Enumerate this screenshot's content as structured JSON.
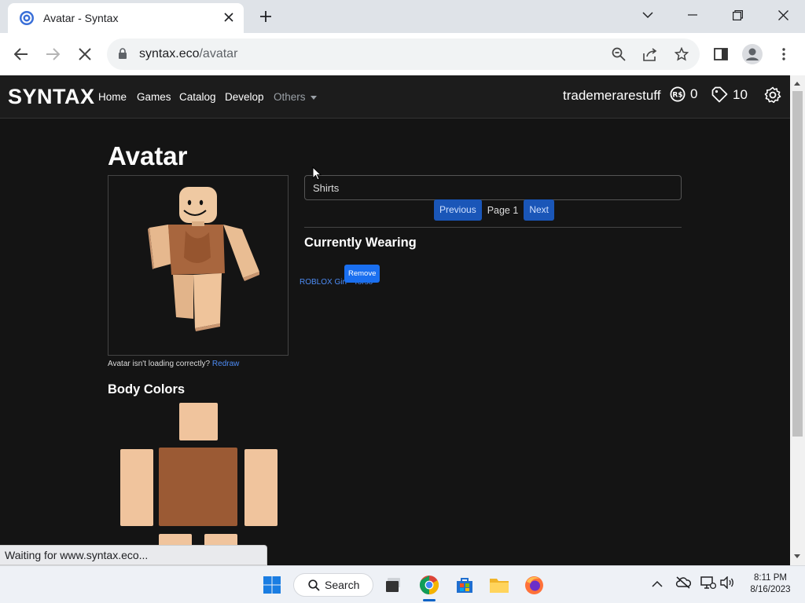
{
  "browser": {
    "tab_title": "Avatar - Syntax",
    "url_domain": "syntax.eco",
    "url_path": "/avatar",
    "status_text": "Waiting for www.syntax.eco..."
  },
  "site": {
    "brand": "SYNTAX",
    "nav": [
      "Home",
      "Games",
      "Catalog",
      "Develop"
    ],
    "nav_dropdown": "Others",
    "username": "trademerarestuff",
    "robux": "0",
    "tickets": "10"
  },
  "avatar_page": {
    "title": "Avatar",
    "loading_help": "Avatar isn't loading correctly?",
    "redraw_link": "Redraw",
    "body_colors_title": "Body Colors",
    "body_colors": {
      "head": "#f0c49d",
      "torso": "#9b5a34",
      "left_arm": "#f0c49d",
      "right_arm": "#f0c49d",
      "left_leg": "#f0c49d",
      "right_leg": "#f0c49d"
    },
    "category_field": "Shirts",
    "pager": {
      "previous": "Previous",
      "page": "Page 1",
      "next": "Next"
    },
    "currently_wearing_title": "Currently Wearing",
    "wearing_item": "ROBLOX Girl - Torso",
    "remove_label": "Remove"
  },
  "taskbar": {
    "search_label": "Search",
    "time": "8:11 PM",
    "date": "8/16/2023"
  },
  "colors": {
    "page_bg": "#141414",
    "link": "#4d8cf5",
    "button": "#1a56b8"
  }
}
